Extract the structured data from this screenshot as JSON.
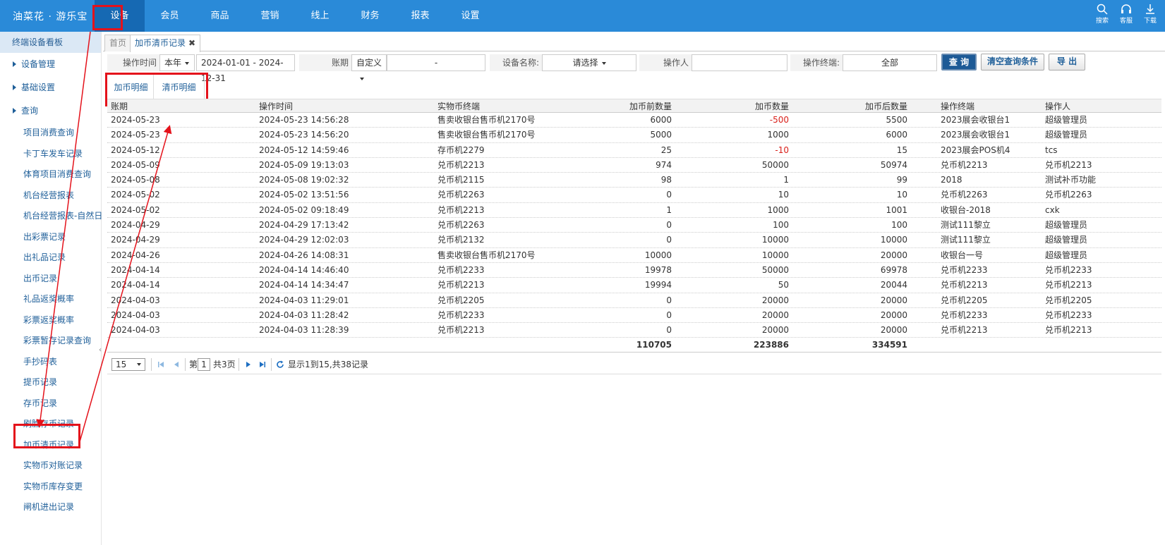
{
  "app": {
    "brand": "油菜花 · 游乐宝"
  },
  "nav": {
    "items": [
      "设备",
      "会员",
      "商品",
      "营销",
      "线上",
      "财务",
      "报表",
      "设置"
    ],
    "active": "设备"
  },
  "tools": [
    {
      "label": "搜索",
      "icon": "search-icon"
    },
    {
      "label": "客服",
      "icon": "headset-icon"
    },
    {
      "label": "下载",
      "icon": "download-icon"
    }
  ],
  "sidebar": {
    "header": "终端设备看板",
    "groups": [
      "设备管理",
      "基础设置",
      "查询"
    ],
    "items": [
      "项目消费查询",
      "卡丁车发车记录",
      "体育项目消费查询",
      "机台经营报表",
      "机台经营报表-自然日",
      "出彩票记录",
      "出礼品记录",
      "出币记录",
      "礼品返奖概率",
      "彩票返奖概率",
      "彩票暂存记录查询",
      "手抄码表",
      "提币记录",
      "存币记录",
      "刷脸存币记录",
      "加币清币记录",
      "实物币对账记录",
      "实物币库存变更",
      "闸机进出记录"
    ],
    "active": "加币清币记录"
  },
  "tabs": {
    "home": "首页",
    "current": "加币清币记录",
    "close": "✖"
  },
  "filter": {
    "op_time_label": "操作时间",
    "op_time_period": "本年",
    "op_time_range": "2024-01-01 - 2024-12-31",
    "period_label": "账期",
    "period_mode": "自定义",
    "period_range": "-",
    "device_label": "设备名称:",
    "device_value": "请选择",
    "operator_label": "操作人",
    "operator_value": "",
    "terminal_label": "操作终端:",
    "terminal_value": "全部",
    "btn_query": "查 询",
    "btn_clear": "清空查询条件",
    "btn_export": "导 出"
  },
  "subtabs": [
    "加币明细",
    "清币明细"
  ],
  "table": {
    "headers": [
      "账期",
      "操作时间",
      "实物币终端",
      "加币前数量",
      "加币数量",
      "加币后数量",
      "操作终端",
      "操作人"
    ],
    "rows": [
      [
        "2024-05-23",
        "2024-05-23 14:56:28",
        "售卖收银台售币机2170号",
        "6000",
        "-500",
        "5500",
        "2023展会收银台1",
        "超级管理员"
      ],
      [
        "2024-05-23",
        "2024-05-23 14:56:20",
        "售卖收银台售币机2170号",
        "5000",
        "1000",
        "6000",
        "2023展会收银台1",
        "超级管理员"
      ],
      [
        "2024-05-12",
        "2024-05-12 14:59:46",
        "存币机2279",
        "25",
        "-10",
        "15",
        "2023展会POS机4",
        "tcs"
      ],
      [
        "2024-05-09",
        "2024-05-09 19:13:03",
        "兑币机2213",
        "974",
        "50000",
        "50974",
        "兑币机2213",
        "兑币机2213"
      ],
      [
        "2024-05-08",
        "2024-05-08 19:02:32",
        "兑币机2115",
        "98",
        "1",
        "99",
        "2018",
        "测试补币功能"
      ],
      [
        "2024-05-02",
        "2024-05-02 13:51:56",
        "兑币机2263",
        "0",
        "10",
        "10",
        "兑币机2263",
        "兑币机2263"
      ],
      [
        "2024-05-02",
        "2024-05-02 09:18:49",
        "兑币机2213",
        "1",
        "1000",
        "1001",
        "收银台-2018",
        "cxk"
      ],
      [
        "2024-04-29",
        "2024-04-29 17:13:42",
        "兑币机2263",
        "0",
        "100",
        "100",
        "测试111黎立",
        "超级管理员"
      ],
      [
        "2024-04-29",
        "2024-04-29 12:02:03",
        "兑币机2132",
        "0",
        "10000",
        "10000",
        "测试111黎立",
        "超级管理员"
      ],
      [
        "2024-04-26",
        "2024-04-26 14:08:31",
        "售卖收银台售币机2170号",
        "10000",
        "10000",
        "20000",
        "收银台一号",
        "超级管理员"
      ],
      [
        "2024-04-14",
        "2024-04-14 14:46:40",
        "兑币机2233",
        "19978",
        "50000",
        "69978",
        "兑币机2233",
        "兑币机2233"
      ],
      [
        "2024-04-14",
        "2024-04-14 14:34:47",
        "兑币机2213",
        "19994",
        "50",
        "20044",
        "兑币机2213",
        "兑币机2213"
      ],
      [
        "2024-04-03",
        "2024-04-03 11:29:01",
        "兑币机2205",
        "0",
        "20000",
        "20000",
        "兑币机2205",
        "兑币机2205"
      ],
      [
        "2024-04-03",
        "2024-04-03 11:28:42",
        "兑币机2233",
        "0",
        "20000",
        "20000",
        "兑币机2233",
        "兑币机2233"
      ],
      [
        "2024-04-03",
        "2024-04-03 11:28:39",
        "兑币机2213",
        "0",
        "20000",
        "20000",
        "兑币机2213",
        "兑币机2213"
      ]
    ],
    "totals": [
      "110705",
      "223886",
      "334591"
    ]
  },
  "pager": {
    "page_size": "15",
    "page_prefix": "第",
    "page": "1",
    "page_suffix": "共3页",
    "summary": "显示1到15,共38记录"
  },
  "colors": {
    "topbar": "#2a8ad8",
    "highlight": "#e4121b",
    "negative": "#d9201a",
    "link": "#1f5f99"
  }
}
